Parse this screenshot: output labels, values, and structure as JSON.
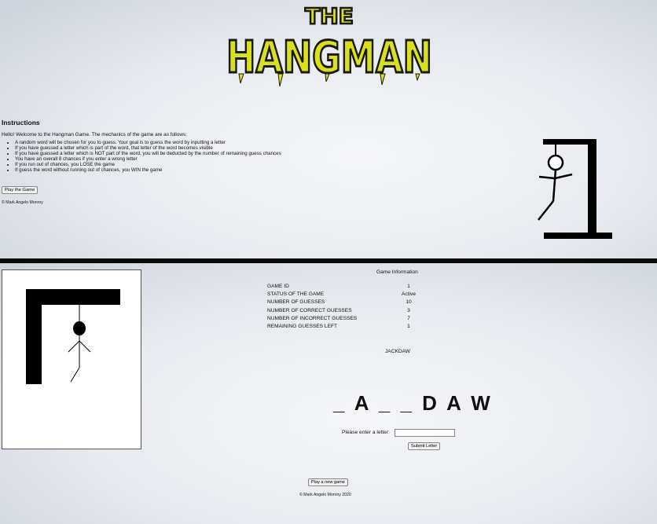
{
  "logo": {
    "line1": "THE",
    "line2": "HANGMAN"
  },
  "instructions": {
    "title": "Instructions",
    "intro": "Hello! Welcome to the Hangman Game. The mechanics of the game are as follows:",
    "rules": [
      "A random word will be chosen for you to guess. Your goal is to guess the word by inputting a letter",
      "If you have guessed a letter which is part of the word, that letter of the word becomes visible",
      "If you have guessed a letter which is NOT part of the word, you will be deducted by the number of remaining guess chances",
      "You have an overall 8 chances if you enter a wrong letter",
      "If you run out of chances, you LOSE the game",
      "If guess the word without running out of chances, you WIN the game"
    ],
    "play_button": "Play the Game",
    "copyright": "© Mark Angelo Monroy"
  },
  "game_info": {
    "title": "Game Information",
    "rows": [
      {
        "label": "GAME ID",
        "value": "1"
      },
      {
        "label": "STATUS OF THE GAME",
        "value": "Active"
      },
      {
        "label": "NUMBER OF GUESSES",
        "value": "10"
      },
      {
        "label": "NUMBER OF CORRECT GUESSES",
        "value": "3"
      },
      {
        "label": "NUMBER OF INCORRECT GUESSES",
        "value": "7"
      },
      {
        "label": "REMAINING GUESSES LEFT",
        "value": "1"
      }
    ]
  },
  "secret_word": "JACKDAW",
  "masked_word": "_ A _ _ D A W",
  "letter_prompt": "Please enter a letter:",
  "letter_input_value": "",
  "submit_button": "Submit Letter",
  "new_game_button": "Play a new game",
  "copyright_bottom": "© Mark Angelo Monroy 2020",
  "colors": {
    "logo_fill": "#d8e021",
    "logo_outline": "#1a1a0a",
    "ink": "#000000"
  }
}
